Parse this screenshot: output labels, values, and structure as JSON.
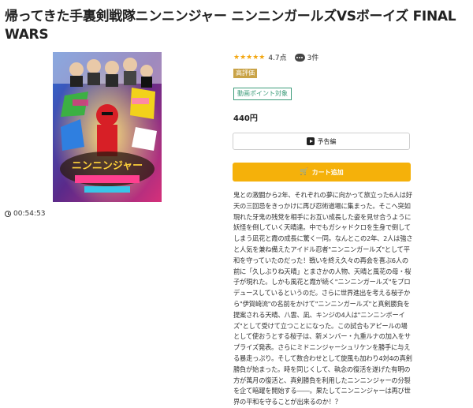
{
  "title": "帰ってきた手裏剣戦隊ニンニンジャー ニンニンガールズVSボーイズ FINAL WARS",
  "duration": "00:54:53",
  "rating": {
    "stars": "★★★★★",
    "score": "4.7点",
    "comments": "3件"
  },
  "badges": {
    "high_rating": "高評価",
    "point": "動画ポイント対象"
  },
  "price": "440円",
  "buttons": {
    "trailer": "予告編",
    "add_to_cart": "カート追加"
  },
  "icons": {
    "clock": "clock-icon",
    "comment": "comment-icon",
    "play": "play-icon",
    "cart": "cart-icon"
  },
  "colors": {
    "accent": "#f5b10a",
    "star": "#f3a712",
    "badge_gold": "#c9a347",
    "point_green": "#3d9c7a"
  },
  "description": "鬼との激闘から2年、それぞれの夢に向かって旅立った6人は好天の三回忌をきっかけに再び忍術道場に集まった。そこへ突如現れた牙鬼の残党を相手にお互い成長した姿を見せ合うように妖怪を倒していく天晴達。中でもガシャドクロを生身で倒してしまう凪花と霞の成長に驚く一同。なんとこの2年、2人は強さと人気を兼ね備えたアイドル忍者\"ニンニンガールズ\"として平和を守っていたのだった！戦いを終え久々の再会を喜ぶ6人の前に「久しぶりね天晴」とまさかの人物、天晴と風花の母・桜子が現れた。しかも風花と霞が続く\"ニンニンガールズ\"をプロデュースしているというのだ。さらに世界進出を考える桜子から\"伊賀崎流\"の名前をかけて\"ニンニンガールズ\"と真剣勝負を提案される天晴、八雲、凪、キンジの4人は\"ニンニンボーイズ\"として受けて立つことになった。この試合もアピールの場として使おうとする桜子は、新メンバー・九重ルナの加入をサプライズ発表。さらにミドニンジャーシュリケンを勝手に与える暴走っぷり。そして数合わせとして旋風も加わり4対4の真剣勝負が始まった。時を同じくして、執念の復活を遂げた有明の方が萬月の復活と、真剣勝負を利用したニンニンジャーの分裂を企て暗躍を開始する――。果たしてニンニンジャーは再び世界の平和を守ることが出来るのか！？"
}
